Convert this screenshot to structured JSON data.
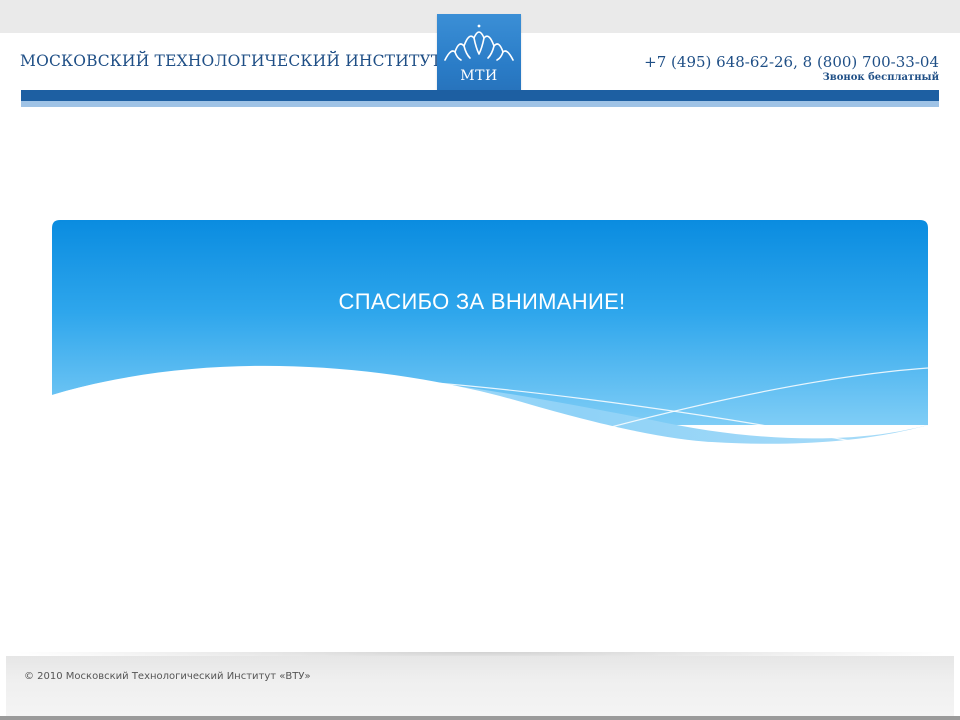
{
  "header": {
    "organization": "МОСКОВСКИЙ ТЕХНОЛОГИЧЕСКИЙ ИНСТИТУТ",
    "logo_text": "МТИ",
    "phones": "+7 (495) 648-62-26,  8 (800) 700-33-04",
    "toll_free_note": "Звонок бесплатный"
  },
  "slide": {
    "title": "СПАСИБО ЗА ВНИМАНИЕ!"
  },
  "footer": {
    "copyright": "© 2010 Московский Технологический Институт «ВТУ»"
  },
  "colors": {
    "brand_dark_blue": "#1d5fa2",
    "brand_text_blue": "#1f4f86",
    "banner_blue": "#0f8fdf",
    "banner_light_blue": "#65bff2"
  },
  "icons": {
    "logo": "mountain-peaks-icon"
  }
}
